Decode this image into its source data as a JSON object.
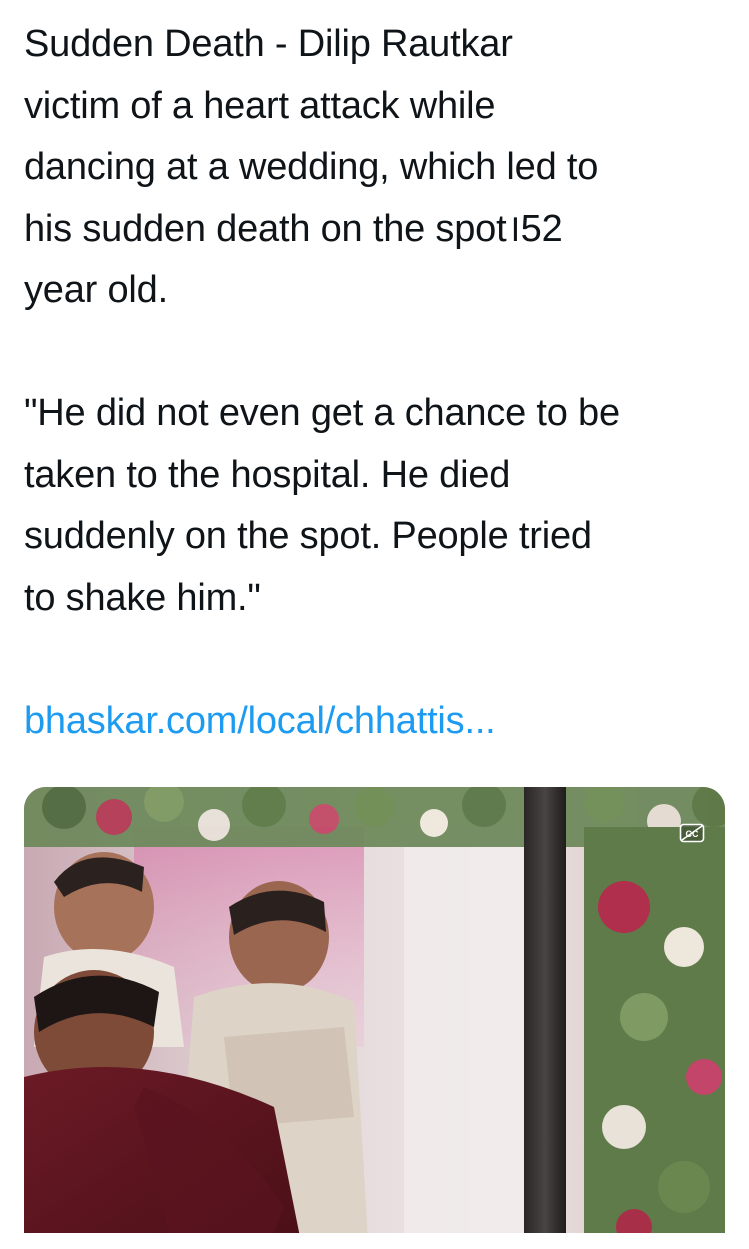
{
  "tweet": {
    "paragraph1": [
      "Sudden Death - Dilip Rautkar",
      "victim of a heart attack while",
      "dancing at a wedding, which led to",
      "his sudden death on the spot।52",
      "year old."
    ],
    "paragraph2": [
      "\"He did not even get a chance to be",
      "taken to the hospital. He died",
      "suddenly on the spot. People tried",
      "to shake him.\""
    ],
    "link_text": "bhaskar.com/local/chhattis..."
  },
  "media": {
    "icon": "captions-off-icon"
  },
  "colors": {
    "text": "#0f1419",
    "link": "#1d9bf0",
    "background": "#ffffff"
  }
}
